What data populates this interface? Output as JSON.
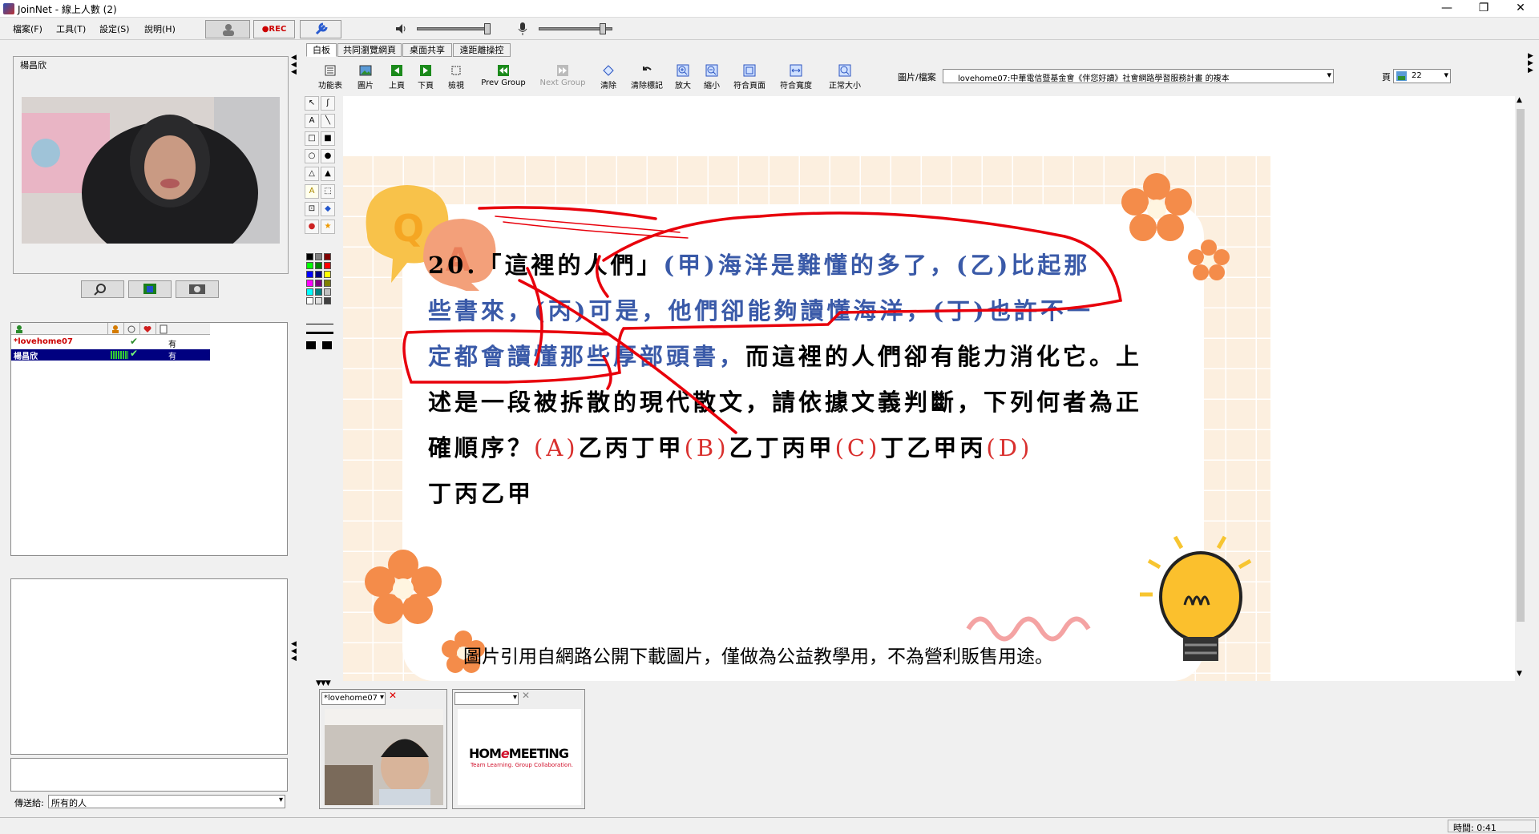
{
  "window": {
    "title": "JoinNet - 線上人數 (2)",
    "minimize": "—",
    "maximize": "❐",
    "close": "✕"
  },
  "menu": [
    {
      "label": "檔案(F)"
    },
    {
      "label": "工具(T)"
    },
    {
      "label": "設定(S)"
    },
    {
      "label": "說明(H)"
    }
  ],
  "toolbar": {
    "rec_label": "●REC"
  },
  "left": {
    "self_video_name": "楊昌欣",
    "users_table": {
      "rows": [
        {
          "name": "*lovehome07",
          "status": "有"
        },
        {
          "name": "楊昌欣",
          "status": "有"
        }
      ]
    },
    "send_to_label": "傳送給:",
    "send_to_value": "所有的人"
  },
  "tabs": [
    {
      "label": "白板"
    },
    {
      "label": "共同瀏覽網頁"
    },
    {
      "label": "桌面共享"
    },
    {
      "label": "遠距離操控"
    }
  ],
  "wb_tools": [
    {
      "label": "功能表"
    },
    {
      "label": "圖片"
    },
    {
      "label": "上頁"
    },
    {
      "label": "下頁"
    },
    {
      "label": "檢視"
    },
    {
      "label": "Prev Group"
    },
    {
      "label": "Next Group"
    },
    {
      "label": "清除"
    },
    {
      "label": "清除標記"
    },
    {
      "label": "放大"
    },
    {
      "label": "縮小"
    },
    {
      "label": "符合頁面"
    },
    {
      "label": "符合寬度"
    },
    {
      "label": "正常大小"
    }
  ],
  "file_select": {
    "label": "圖片/檔案",
    "value": "lovehome07:中華電信暨基金會《伴您好讀》社會網路學習服務計畫 的複本"
  },
  "page_select": {
    "label": "頁",
    "value": "22"
  },
  "slide": {
    "qa_q": "Q",
    "qa_a": "A",
    "line1_a": "20.「這裡的人們」",
    "line1_b": "(甲)海洋是難懂的多了，(乙)比起那",
    "line2": "些書來，(丙)可是，他們卻能夠讀懂海洋，(丁)也許不一",
    "line3_a": "定都會讀懂那些厚部頭書，",
    "line3_b": "而這裡的人們卻有能力消化它。上",
    "line4": "述是一段被拆散的現代散文，請依據文義判斷，下列何者為正",
    "line5_a": "確順序？",
    "opt_a_key": "(A)",
    "opt_a": "乙丙丁甲",
    "opt_b_key": "(B)",
    "opt_b": "乙丁丙甲",
    "opt_c_key": "(C)",
    "opt_c": "丁乙甲丙",
    "opt_d_key": "(D)",
    "line6": "丁丙乙甲",
    "footer": "圖片引用自網路公開下載圖片，僅做為公益教學用，不為營利販售用途。"
  },
  "bottom": {
    "video1_name": "*lovehome07",
    "logo_main_a": "HOM",
    "logo_main_e": "e",
    "logo_main_b": "MEETING",
    "logo_sub": "Team Learning. Group Collaboration."
  },
  "status": {
    "time": "時間: 0:41"
  },
  "colors": {
    "accent_blue": "#3a5aa8",
    "pen_red": "#e8000b",
    "selected_row": "#000080"
  }
}
